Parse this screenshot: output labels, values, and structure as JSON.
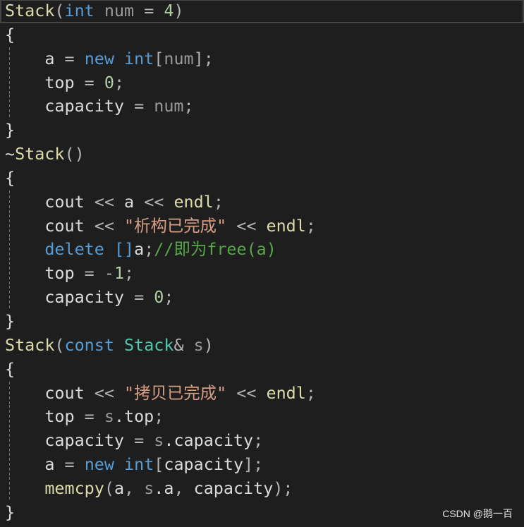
{
  "theme": {
    "syntax": {
      "keyword": "#569cd6",
      "function": "#dcdcaa",
      "type": "#4ec9b0",
      "parameter": "#9a9a9a",
      "identifier": "#dadada",
      "punctuation": "#b4b4b4",
      "number": "#b5cea8",
      "string": "#d69d85",
      "comment": "#57a64a",
      "text": "#dcdcdc"
    }
  },
  "editor": {
    "current_line": 1,
    "lines": [
      {
        "tokens": [
          [
            "Stack",
            "#dcdcaa"
          ],
          [
            "(",
            "#b4b4b4"
          ],
          [
            "int",
            "#569cd6"
          ],
          [
            " ",
            "#dcdcdc"
          ],
          [
            "num",
            "#9a9a9a"
          ],
          [
            " = ",
            "#b4b4b4"
          ],
          [
            "4",
            "#b5cea8"
          ],
          [
            ")",
            "#b4b4b4"
          ]
        ]
      },
      {
        "tokens": [
          [
            "{",
            "#dcdcdc"
          ]
        ]
      },
      {
        "tokens": [
          [
            "    ",
            "#dcdcdc"
          ],
          [
            "a",
            "#dadada"
          ],
          [
            " = ",
            "#b4b4b4"
          ],
          [
            "new",
            "#569cd6"
          ],
          [
            " ",
            "#dcdcdc"
          ],
          [
            "int",
            "#569cd6"
          ],
          [
            "[",
            "#b4b4b4"
          ],
          [
            "num",
            "#9a9a9a"
          ],
          [
            "];",
            "#b4b4b4"
          ]
        ]
      },
      {
        "tokens": [
          [
            "    ",
            "#dcdcdc"
          ],
          [
            "top",
            "#dadada"
          ],
          [
            " = ",
            "#b4b4b4"
          ],
          [
            "0",
            "#b5cea8"
          ],
          [
            ";",
            "#b4b4b4"
          ]
        ]
      },
      {
        "tokens": [
          [
            "    ",
            "#dcdcdc"
          ],
          [
            "capacity",
            "#dadada"
          ],
          [
            " = ",
            "#b4b4b4"
          ],
          [
            "num",
            "#9a9a9a"
          ],
          [
            ";",
            "#b4b4b4"
          ]
        ]
      },
      {
        "tokens": [
          [
            "}",
            "#dcdcdc"
          ]
        ]
      },
      {
        "tokens": [
          [
            "~",
            "#dcdcdc"
          ],
          [
            "Stack",
            "#dcdcaa"
          ],
          [
            "()",
            "#b4b4b4"
          ]
        ]
      },
      {
        "tokens": [
          [
            "{",
            "#dcdcdc"
          ]
        ]
      },
      {
        "tokens": [
          [
            "    ",
            "#dcdcdc"
          ],
          [
            "cout",
            "#dadada"
          ],
          [
            " << ",
            "#b4b4b4"
          ],
          [
            "a",
            "#dadada"
          ],
          [
            " << ",
            "#b4b4b4"
          ],
          [
            "endl",
            "#dcdcaa"
          ],
          [
            ";",
            "#b4b4b4"
          ]
        ]
      },
      {
        "tokens": [
          [
            "    ",
            "#dcdcdc"
          ],
          [
            "cout",
            "#dadada"
          ],
          [
            " << ",
            "#b4b4b4"
          ],
          [
            "\"析构已完成\"",
            "#d69d85"
          ],
          [
            " << ",
            "#b4b4b4"
          ],
          [
            "endl",
            "#dcdcaa"
          ],
          [
            ";",
            "#b4b4b4"
          ]
        ]
      },
      {
        "tokens": [
          [
            "    ",
            "#dcdcdc"
          ],
          [
            "delete",
            "#569cd6"
          ],
          [
            " ",
            "#dcdcdc"
          ],
          [
            "[]",
            "#569cd6"
          ],
          [
            "a",
            "#dadada"
          ],
          [
            ";",
            "#b4b4b4"
          ],
          [
            "//即为free(a)",
            "#57a64a"
          ]
        ]
      },
      {
        "tokens": [
          [
            "    ",
            "#dcdcdc"
          ],
          [
            "top",
            "#dadada"
          ],
          [
            " = ",
            "#b4b4b4"
          ],
          [
            "-",
            "#b4b4b4"
          ],
          [
            "1",
            "#b5cea8"
          ],
          [
            ";",
            "#b4b4b4"
          ]
        ]
      },
      {
        "tokens": [
          [
            "    ",
            "#dcdcdc"
          ],
          [
            "capacity",
            "#dadada"
          ],
          [
            " = ",
            "#b4b4b4"
          ],
          [
            "0",
            "#b5cea8"
          ],
          [
            ";",
            "#b4b4b4"
          ]
        ]
      },
      {
        "tokens": [
          [
            "}",
            "#dcdcdc"
          ]
        ]
      },
      {
        "tokens": [
          [
            "Stack",
            "#dcdcaa"
          ],
          [
            "(",
            "#b4b4b4"
          ],
          [
            "const",
            "#569cd6"
          ],
          [
            " ",
            "#dcdcdc"
          ],
          [
            "Stack",
            "#4ec9b0"
          ],
          [
            "&",
            "#b4b4b4"
          ],
          [
            " ",
            "#dcdcdc"
          ],
          [
            "s",
            "#9a9a9a"
          ],
          [
            ")",
            "#b4b4b4"
          ]
        ]
      },
      {
        "tokens": [
          [
            "{",
            "#dcdcdc"
          ]
        ]
      },
      {
        "tokens": [
          [
            "    ",
            "#dcdcdc"
          ],
          [
            "cout",
            "#dadada"
          ],
          [
            " << ",
            "#b4b4b4"
          ],
          [
            "\"拷贝已完成\"",
            "#d69d85"
          ],
          [
            " << ",
            "#b4b4b4"
          ],
          [
            "endl",
            "#dcdcaa"
          ],
          [
            ";",
            "#b4b4b4"
          ]
        ]
      },
      {
        "tokens": [
          [
            "    ",
            "#dcdcdc"
          ],
          [
            "top",
            "#dadada"
          ],
          [
            " = ",
            "#b4b4b4"
          ],
          [
            "s",
            "#9a9a9a"
          ],
          [
            ".top",
            "#dadada"
          ],
          [
            ";",
            "#b4b4b4"
          ]
        ]
      },
      {
        "tokens": [
          [
            "    ",
            "#dcdcdc"
          ],
          [
            "capacity",
            "#dadada"
          ],
          [
            " = ",
            "#b4b4b4"
          ],
          [
            "s",
            "#9a9a9a"
          ],
          [
            ".capacity",
            "#dadada"
          ],
          [
            ";",
            "#b4b4b4"
          ]
        ]
      },
      {
        "tokens": [
          [
            "    ",
            "#dcdcdc"
          ],
          [
            "a",
            "#dadada"
          ],
          [
            " = ",
            "#b4b4b4"
          ],
          [
            "new",
            "#569cd6"
          ],
          [
            " ",
            "#dcdcdc"
          ],
          [
            "int",
            "#569cd6"
          ],
          [
            "[",
            "#b4b4b4"
          ],
          [
            "capacity",
            "#dadada"
          ],
          [
            "];",
            "#b4b4b4"
          ]
        ]
      },
      {
        "tokens": [
          [
            "    ",
            "#dcdcdc"
          ],
          [
            "memcpy",
            "#dcdcaa"
          ],
          [
            "(",
            "#b4b4b4"
          ],
          [
            "a",
            "#dadada"
          ],
          [
            ", ",
            "#b4b4b4"
          ],
          [
            "s",
            "#9a9a9a"
          ],
          [
            ".a",
            "#dadada"
          ],
          [
            ", ",
            "#b4b4b4"
          ],
          [
            "capacity",
            "#dadada"
          ],
          [
            ");",
            "#b4b4b4"
          ]
        ]
      },
      {
        "tokens": [
          [
            "}",
            "#dcdcdc"
          ]
        ]
      }
    ]
  },
  "watermark": {
    "text": "CSDN @鹅一百"
  }
}
